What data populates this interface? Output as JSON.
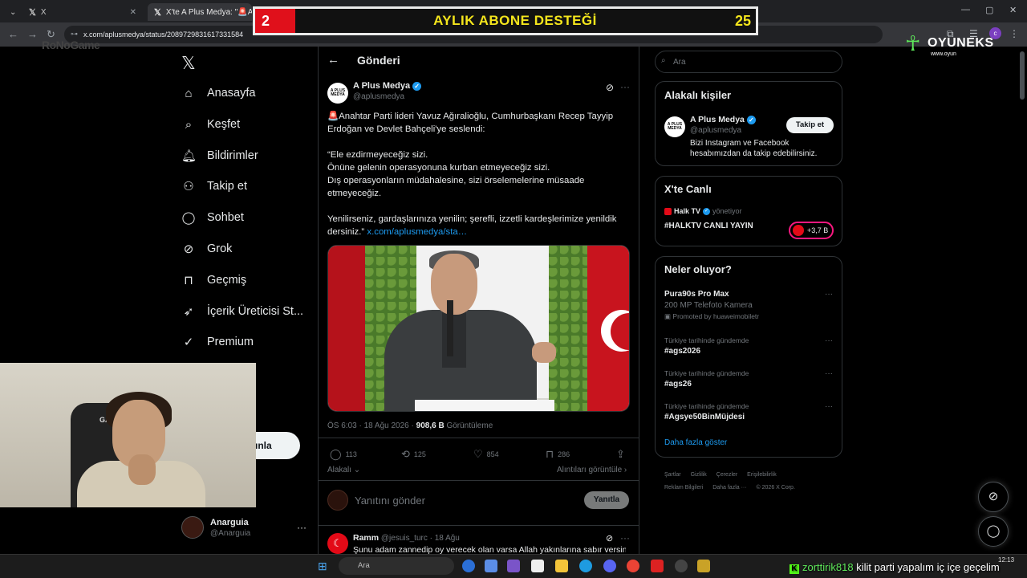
{
  "browser": {
    "tabs": [
      {
        "label": "X"
      },
      {
        "label": "X'te A Plus Medya: \"🚨Ana"
      }
    ],
    "url": "x.com/aplusmedya/status/2089729831617331584"
  },
  "overlay": {
    "sub_goal": {
      "left": "2",
      "title": "AYLIK ABONE DESTEĞİ",
      "right": "25"
    },
    "brand_left": "RoNoGame",
    "brand_right": {
      "word": "OYUNEKS",
      "url": "www.oyun"
    },
    "chat": {
      "user": "zorttirik818",
      "message": "kilit parti yapalım iç içe geçelim"
    }
  },
  "nav": {
    "items": [
      {
        "label": "Anasayfa",
        "icon": "home-icon"
      },
      {
        "label": "Keşfet",
        "icon": "search-icon"
      },
      {
        "label": "Bildirimler",
        "icon": "bell-icon"
      },
      {
        "label": "Takip et",
        "icon": "person-plus-icon"
      },
      {
        "label": "Sohbet",
        "icon": "chat-icon"
      },
      {
        "label": "Grok",
        "icon": "grok-icon"
      },
      {
        "label": "Geçmiş",
        "icon": "bookmark-icon"
      },
      {
        "label": "İçerik Üreticisi St...",
        "icon": "rocket-icon"
      },
      {
        "label": "Premium",
        "icon": "premium-icon"
      }
    ],
    "partial_text": "a",
    "post_button": "ınla",
    "user": {
      "name": "Anarguia",
      "handle": "@Anarguia"
    }
  },
  "post": {
    "header": "Gönderi",
    "author": {
      "name": "A Plus Medya",
      "handle": "@aplusmedya",
      "avatar_text": "A PLUS MEDYA"
    },
    "text_lines": [
      "🚨Anahtar Parti lideri Yavuz Ağıralioğlu, Cumhurbaşkanı Recep Tayyip",
      "Erdoğan ve Devlet Bahçeli'ye seslendi:",
      "",
      "“Ele ezdirmeyeceğiz sizi.",
      "Önüne gelenin operasyonuna kurban etmeyeceğiz sizi.",
      "Dış operasyonların müdahalesine, sizi örselemelerine müsaade",
      "etmeyeceğiz.",
      "",
      "Yenilirseniz, gardaşlarınıza yenilin; şerefli, izzetli kardeşlerimize yenildik"
    ],
    "last_line_prefix": "dersiniz.”",
    "link": "x.com/aplusmedya/sta…",
    "time": "ÖS 6:03 · 18 Ağu 2026 · ",
    "views": "908,6 B",
    "views_label": " Görüntüleme",
    "stats": {
      "replies": "113",
      "reposts": "125",
      "likes": "854",
      "bookmarks": "286"
    },
    "alakali": "Alakalı ⌄",
    "alintilar": "Alıntıları görüntüle ›",
    "reply_placeholder": "Yanıtını gönder",
    "reply_button": "Yanıtla"
  },
  "comment": {
    "name": "Ramm",
    "meta": " @jesuis_turc · 18 Ağu",
    "text": "Şunu adam zannedip oy verecek olan varsa Allah yakınlarına sabır versin"
  },
  "right": {
    "search_placeholder": "Ara",
    "related": {
      "title": "Alakalı kişiler",
      "name": "A Plus Medya",
      "handle": "@aplusmedya",
      "follow": "Takip et",
      "bio": "Bizi Instagram ve Facebook hesabımızdan da takip edebilirsiniz."
    },
    "live": {
      "title": "X'te Canlı",
      "host": "Halk TV",
      "role": "yönetiyor",
      "stream": "#HALKTV CANLI YAYIN",
      "count": "+3,7 B"
    },
    "trends": {
      "title": "Neler oluyor?",
      "promo": {
        "title": "Pura90s Pro Max",
        "sub": "200 MP Telefoto Kamera",
        "by": "Promoted by huaweimobiletr"
      },
      "items": [
        {
          "context": "Türkiye tarihinde gündemde",
          "tag": "#ags2026"
        },
        {
          "context": "Türkiye tarihinde gündemde",
          "tag": "#ags26"
        },
        {
          "context": "Türkiye tarihinde gündemde",
          "tag": "#Agsye50BinMüjdesi"
        }
      ],
      "show_more": "Daha fazla göster"
    },
    "footer": [
      "Şartlar",
      "Gizlilik",
      "Çerezler",
      "Erişilebilirlik",
      "Reklam Bilgileri",
      "Daha fazla ···",
      "© 2026 X Corp."
    ]
  },
  "taskbar": {
    "search": "Ara",
    "time": "12:13"
  },
  "colors": {
    "accent": "#1d9bf0",
    "background": "#000000",
    "banner_red": "#e0101b",
    "banner_yellow": "#f4e51c"
  }
}
